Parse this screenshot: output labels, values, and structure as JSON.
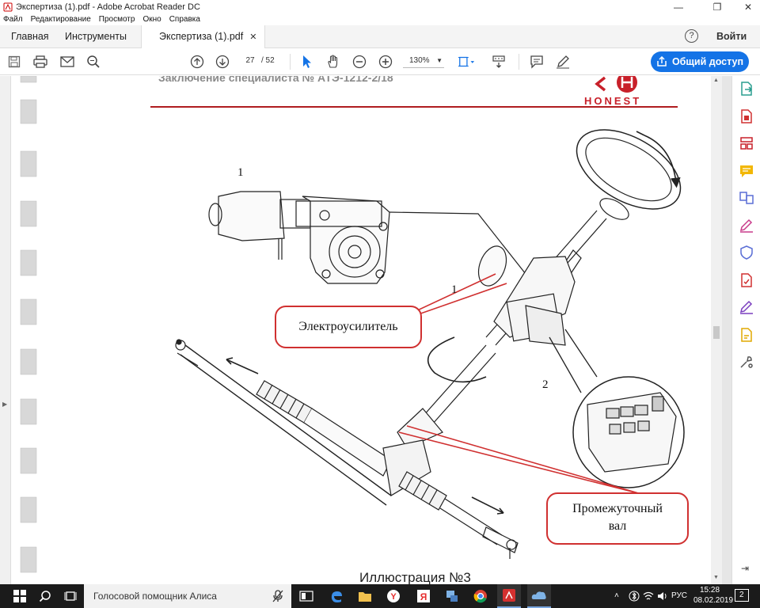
{
  "window": {
    "title": "Экспертиза  (1).pdf - Adobe Acrobat Reader DC",
    "minimize": "—",
    "maximize": "❐",
    "close": "✕"
  },
  "menu": [
    "Файл",
    "Редактирование",
    "Просмотр",
    "Окно",
    "Справка"
  ],
  "tabs": {
    "home": "Главная",
    "tools": "Инструменты",
    "document": "Экспертиза  (1).pdf",
    "close": "✕"
  },
  "header": {
    "help": "?",
    "login": "Войти",
    "share": "Общий доступ"
  },
  "toolbar": {
    "page_current": "27",
    "page_total": "/  52",
    "zoom": "130%",
    "icons": [
      "save-icon",
      "print-icon",
      "email-icon",
      "search-icon",
      "page-up-icon",
      "page-down-icon",
      "select-cursor-icon",
      "hand-icon",
      "zoom-out-icon",
      "zoom-in-icon",
      "fit-page-icon",
      "scroll-mode-icon",
      "comment-icon",
      "sign-icon"
    ]
  },
  "document": {
    "header_text": "Заключение специалиста № АТЭ-1212-2/18",
    "logo_text": "HONEST",
    "callout_amplifier": "Электроусилитель",
    "callout_shaft_line1": "Промежуточный",
    "callout_shaft_line2": "вал",
    "label_1_motor": "1",
    "label_1_column": "1",
    "label_2": "2",
    "caption": "Иллюстрация №3",
    "colors": {
      "header_rule": "#b01c20",
      "callout_border": "#d03030",
      "logo_red": "#c8202a"
    }
  },
  "right_panel": [
    "export-pdf-icon",
    "create-pdf-icon",
    "organize-pages-icon",
    "comment-tool-icon",
    "combine-files-icon",
    "fill-sign-icon",
    "protect-icon",
    "send-signature-icon",
    "edit-pdf-icon",
    "send-review-icon",
    "more-tools-icon"
  ],
  "taskbar": {
    "search_placeholder": "Голосовой помощник Алиса",
    "language": "РУС",
    "time": "15:28",
    "date": "08.02.2019",
    "notifications": "2"
  }
}
